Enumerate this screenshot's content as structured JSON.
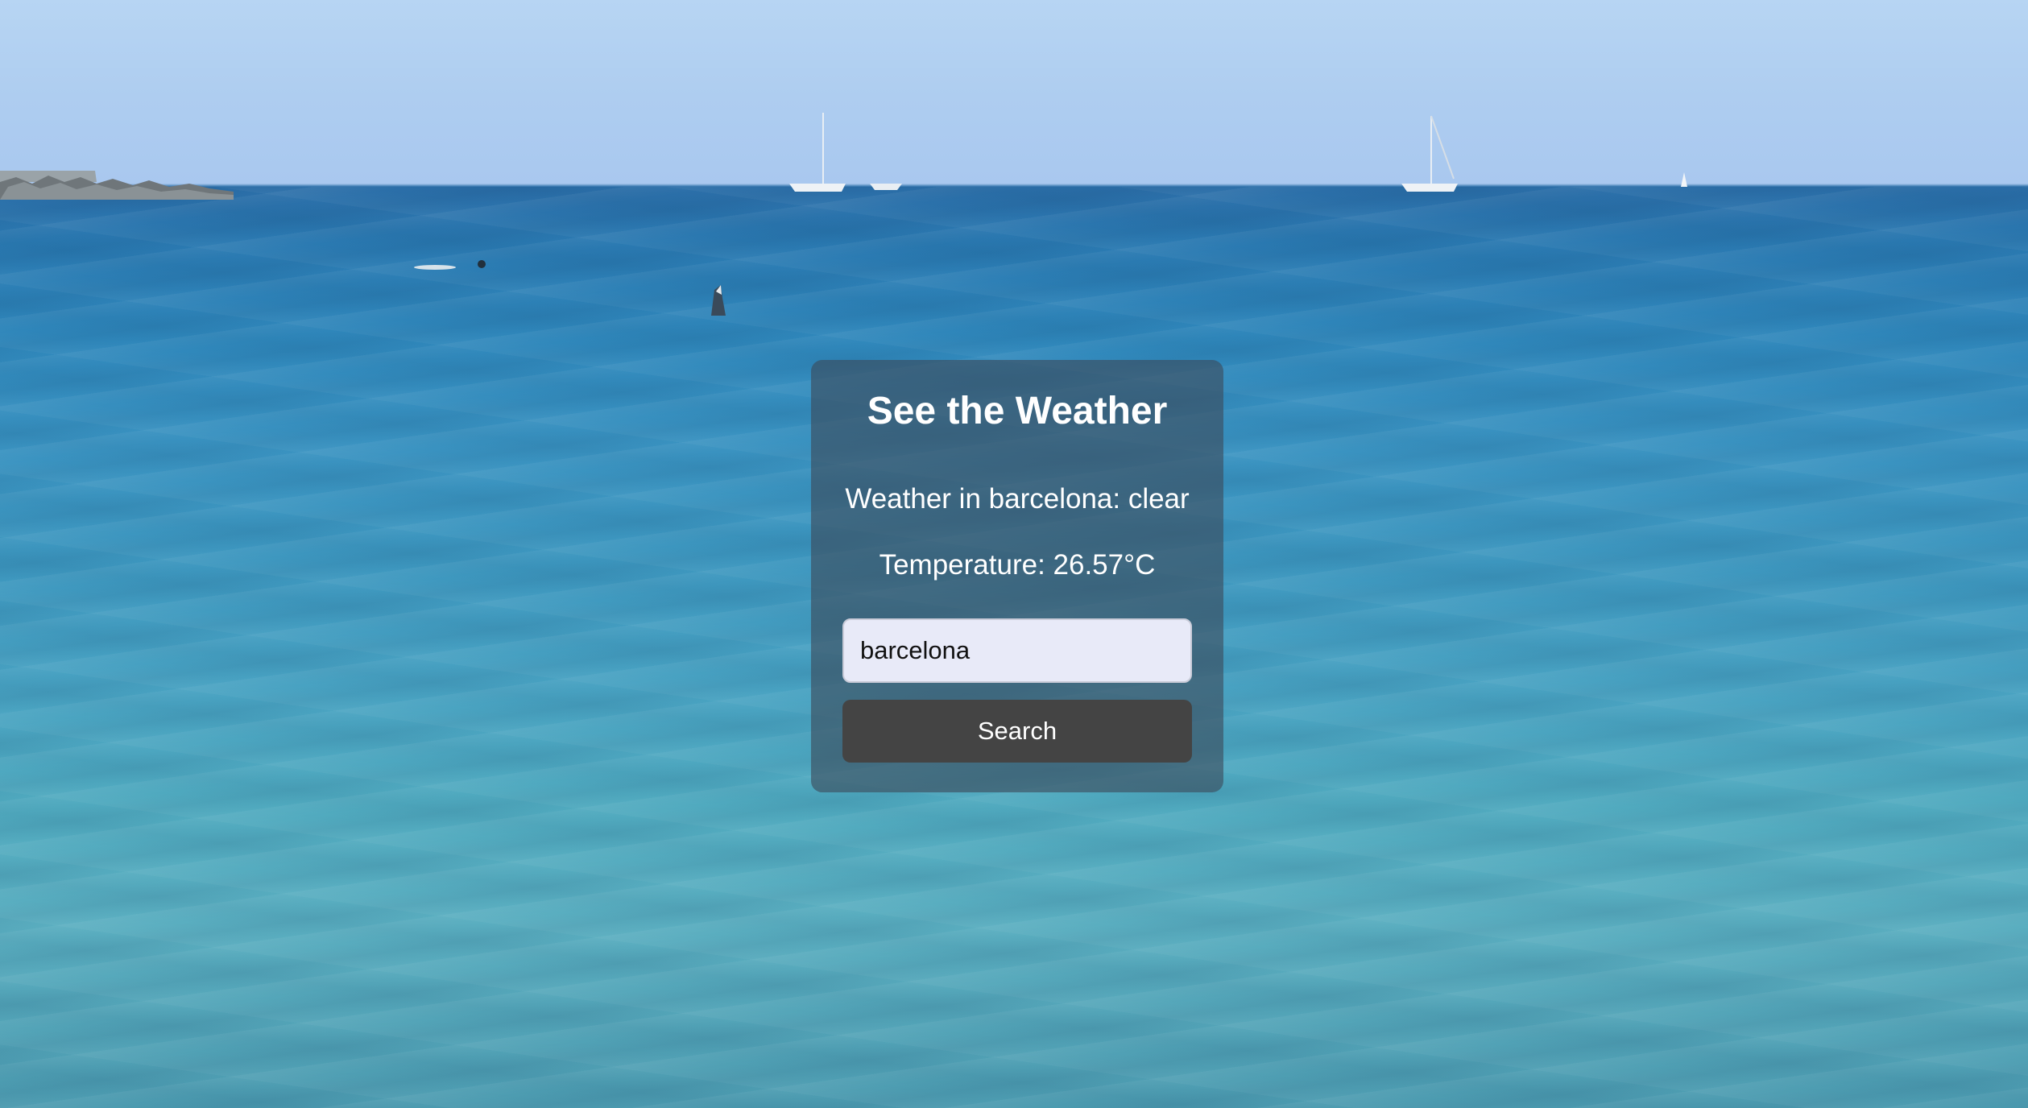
{
  "app": {
    "title": "See the Weather"
  },
  "weather": {
    "description_line": "Weather in barcelona: clear",
    "temperature_line": "Temperature: 26.57°C"
  },
  "search": {
    "value": "barcelona",
    "button_label": "Search"
  },
  "colors": {
    "card_background": "rgba(60,75,90,0.62)",
    "button_background": "#444444",
    "input_background": "#e8eaf8",
    "text": "#ffffff"
  }
}
